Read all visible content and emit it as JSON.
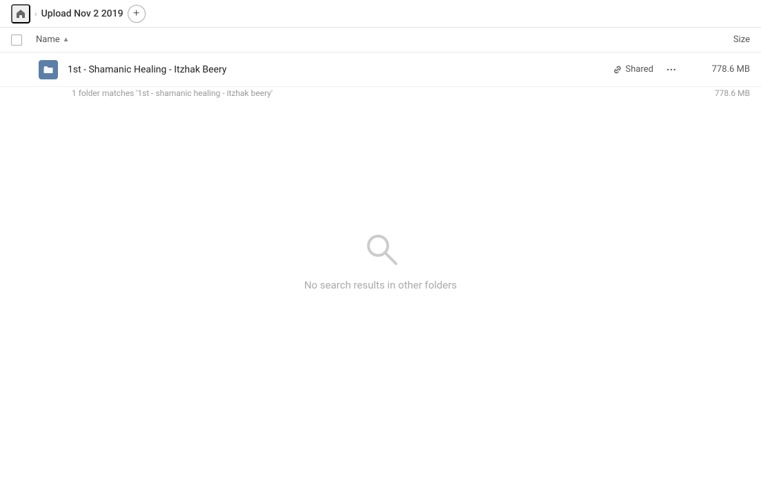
{
  "breadcrumb": {
    "home_label": "Home",
    "folder_name": "Upload Nov 2 2019"
  },
  "add_button_label": "+",
  "columns": {
    "name_label": "Name",
    "size_label": "Size"
  },
  "file_row": {
    "name": "1st - Shamanic Healing - Itzhak Beery",
    "shared_label": "Shared",
    "size": "778.6 MB",
    "more_dots": "···"
  },
  "match_info": {
    "text": "1 folder matches '1st - shamanic healing - itzhak beery'",
    "size": "778.6 MB"
  },
  "empty_state": {
    "message": "No search results in other folders"
  },
  "icons": {
    "home": "🏠",
    "link": "🔗",
    "search": "🔍"
  }
}
